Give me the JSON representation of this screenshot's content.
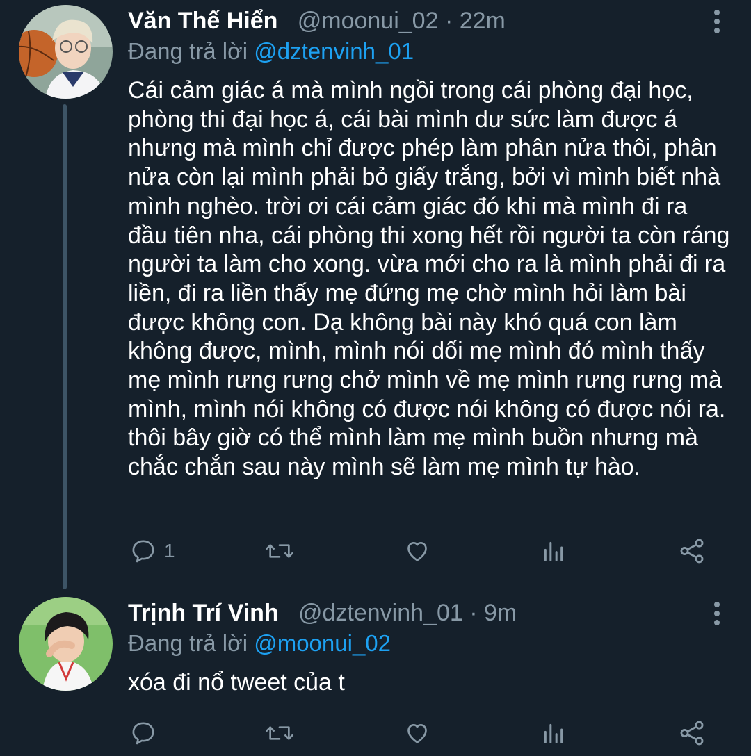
{
  "tweets": [
    {
      "name": "Văn Thế Hiển",
      "handle": "@moonui_02",
      "time": "22m",
      "replying_label": "Đang trả lời",
      "replying_to": "@dztenvinh_01",
      "text": "Cái cảm giác á mà mình ngồi trong cái phòng đại học, phòng thi đại học á, cái bài mình dư sức làm được á nhưng mà mình chỉ được phép làm phân nửa thôi, phân nửa còn lại mình phải bỏ giấy trắng, bởi vì mình biết nhà mình nghèo. trời ơi cái cảm giác đó khi mà mình đi ra đầu tiên nha, cái phòng thi xong hết rồi người ta còn ráng người ta làm cho xong. vừa mới cho ra là mình phải đi ra liền, đi ra liền thấy mẹ đứng mẹ chờ mình hỏi làm bài được không con. Dạ không bài này khó quá con làm không được, mình, mình nói dối mẹ mình đó mình thấy mẹ mình rưng rưng chở mình về mẹ mình rưng rưng mà mình, mình nói không có được nói không có được nói ra. thôi bây giờ có thể mình làm mẹ mình buồn nhưng mà chắc chắn sau này mình sẽ làm mẹ mình tự hào.",
      "reply_count": "1"
    },
    {
      "name": "Trịnh Trí Vinh",
      "handle": "@dztenvinh_01",
      "time": "9m",
      "replying_label": "Đang trả lời",
      "replying_to": "@moonui_02",
      "text": "xóa đi nổ tweet của t",
      "reply_count": ""
    }
  ],
  "separator": " · ",
  "icons": [
    "reply-icon",
    "retweet-icon",
    "like-icon",
    "analytics-icon",
    "share-icon",
    "more-icon"
  ],
  "colors": {
    "background": "#15202b",
    "secondary_text": "#8899a6",
    "link": "#1da1f2",
    "thread_line": "#3d5466"
  }
}
